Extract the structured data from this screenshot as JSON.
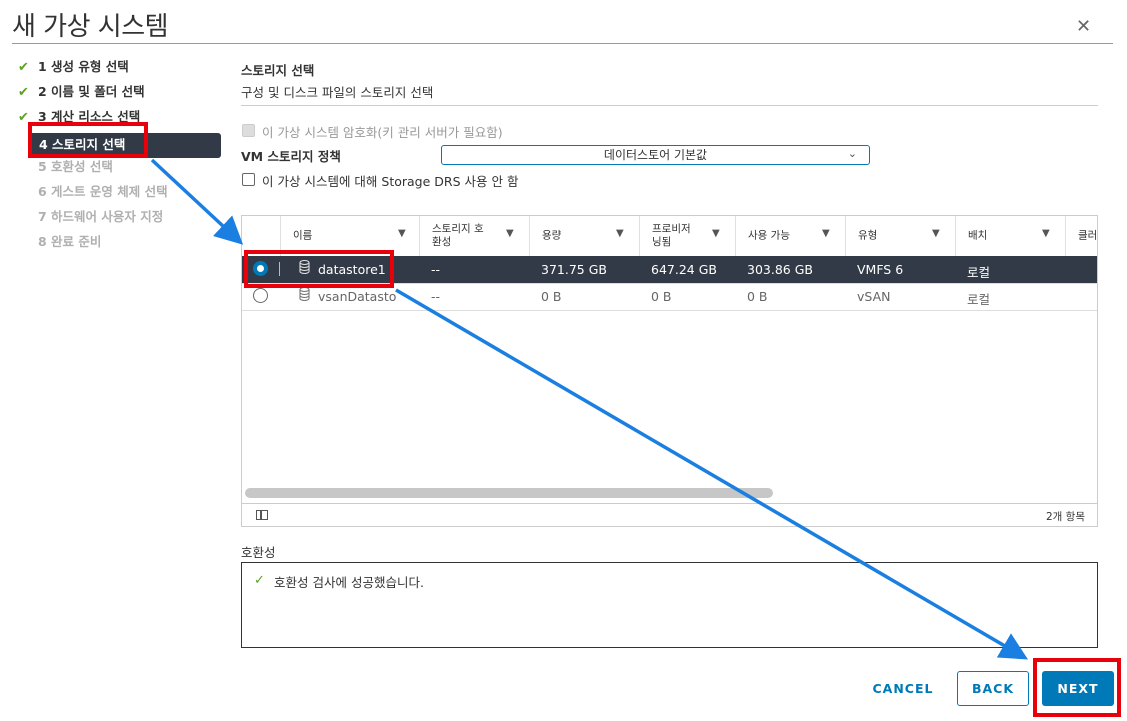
{
  "dialog": {
    "title": "새 가상 시스템"
  },
  "steps": [
    {
      "label": "1 생성 유형 선택",
      "state": "done"
    },
    {
      "label": "2 이름 및 폴더 선택",
      "state": "done"
    },
    {
      "label": "3 계산 리소스 선택",
      "state": "done"
    },
    {
      "label": "4 스토리지 선택",
      "state": "active"
    },
    {
      "label": "5 호환성 선택",
      "state": "todo"
    },
    {
      "label": "6 게스트 운영 체제 선택",
      "state": "todo"
    },
    {
      "label": "7 하드웨어 사용자 지정",
      "state": "todo"
    },
    {
      "label": "8 완료 준비",
      "state": "todo"
    }
  ],
  "storage": {
    "title": "스토리지 선택",
    "subtitle": "구성 및 디스크 파일의 스토리지 선택",
    "encrypt_label": "이 가상 시스템 암호화(키 관리 서버가 필요함)",
    "policy_label": "VM 스토리지 정책",
    "policy_value": "데이터스토어 기본값",
    "drs_label": "이 가상 시스템에 대해 Storage DRS 사용 안 함"
  },
  "table": {
    "headers": {
      "name": "이름",
      "compat_line1": "스토리지 호",
      "compat_line2": "환성",
      "capacity": "용량",
      "prov_line1": "프로비저",
      "prov_line2": "닝됨",
      "free": "사용 가능",
      "type": "유형",
      "placement": "배치",
      "cluster": "클러"
    },
    "rows": [
      {
        "name": "datastore1",
        "compat": "--",
        "capacity": "371.75 GB",
        "provisioned": "647.24 GB",
        "free": "303.86 GB",
        "type": "VMFS 6",
        "placement": "로컬",
        "selected": true
      },
      {
        "name": "vsanDatasto",
        "compat": "--",
        "capacity": "0 B",
        "provisioned": "0 B",
        "free": "0 B",
        "type": "vSAN",
        "placement": "로컬",
        "selected": false
      }
    ],
    "count": "2개 항목"
  },
  "compatibility": {
    "label": "호환성",
    "message": "호환성 검사에 성공했습니다."
  },
  "buttons": {
    "cancel": "CANCEL",
    "back": "BACK",
    "next": "NEXT"
  },
  "colors": {
    "accent": "#0079b8",
    "selected_row": "#313a46",
    "highlight": "#e8000b",
    "arrow": "#1a7fe0",
    "check": "#5aa220"
  }
}
